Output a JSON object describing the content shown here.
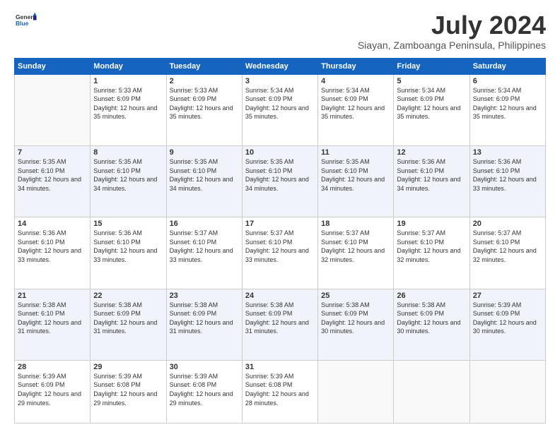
{
  "header": {
    "logo_line1": "General",
    "logo_line2": "Blue",
    "title": "July 2024",
    "subtitle": "Siayan, Zamboanga Peninsula, Philippines"
  },
  "columns": [
    "Sunday",
    "Monday",
    "Tuesday",
    "Wednesday",
    "Thursday",
    "Friday",
    "Saturday"
  ],
  "weeks": [
    [
      {
        "day": "",
        "sunrise": "",
        "sunset": "",
        "daylight": ""
      },
      {
        "day": "1",
        "sunrise": "Sunrise: 5:33 AM",
        "sunset": "Sunset: 6:09 PM",
        "daylight": "Daylight: 12 hours and 35 minutes."
      },
      {
        "day": "2",
        "sunrise": "Sunrise: 5:33 AM",
        "sunset": "Sunset: 6:09 PM",
        "daylight": "Daylight: 12 hours and 35 minutes."
      },
      {
        "day": "3",
        "sunrise": "Sunrise: 5:34 AM",
        "sunset": "Sunset: 6:09 PM",
        "daylight": "Daylight: 12 hours and 35 minutes."
      },
      {
        "day": "4",
        "sunrise": "Sunrise: 5:34 AM",
        "sunset": "Sunset: 6:09 PM",
        "daylight": "Daylight: 12 hours and 35 minutes."
      },
      {
        "day": "5",
        "sunrise": "Sunrise: 5:34 AM",
        "sunset": "Sunset: 6:09 PM",
        "daylight": "Daylight: 12 hours and 35 minutes."
      },
      {
        "day": "6",
        "sunrise": "Sunrise: 5:34 AM",
        "sunset": "Sunset: 6:09 PM",
        "daylight": "Daylight: 12 hours and 35 minutes."
      }
    ],
    [
      {
        "day": "7",
        "sunrise": "Sunrise: 5:35 AM",
        "sunset": "Sunset: 6:10 PM",
        "daylight": "Daylight: 12 hours and 34 minutes."
      },
      {
        "day": "8",
        "sunrise": "Sunrise: 5:35 AM",
        "sunset": "Sunset: 6:10 PM",
        "daylight": "Daylight: 12 hours and 34 minutes."
      },
      {
        "day": "9",
        "sunrise": "Sunrise: 5:35 AM",
        "sunset": "Sunset: 6:10 PM",
        "daylight": "Daylight: 12 hours and 34 minutes."
      },
      {
        "day": "10",
        "sunrise": "Sunrise: 5:35 AM",
        "sunset": "Sunset: 6:10 PM",
        "daylight": "Daylight: 12 hours and 34 minutes."
      },
      {
        "day": "11",
        "sunrise": "Sunrise: 5:35 AM",
        "sunset": "Sunset: 6:10 PM",
        "daylight": "Daylight: 12 hours and 34 minutes."
      },
      {
        "day": "12",
        "sunrise": "Sunrise: 5:36 AM",
        "sunset": "Sunset: 6:10 PM",
        "daylight": "Daylight: 12 hours and 34 minutes."
      },
      {
        "day": "13",
        "sunrise": "Sunrise: 5:36 AM",
        "sunset": "Sunset: 6:10 PM",
        "daylight": "Daylight: 12 hours and 33 minutes."
      }
    ],
    [
      {
        "day": "14",
        "sunrise": "Sunrise: 5:36 AM",
        "sunset": "Sunset: 6:10 PM",
        "daylight": "Daylight: 12 hours and 33 minutes."
      },
      {
        "day": "15",
        "sunrise": "Sunrise: 5:36 AM",
        "sunset": "Sunset: 6:10 PM",
        "daylight": "Daylight: 12 hours and 33 minutes."
      },
      {
        "day": "16",
        "sunrise": "Sunrise: 5:37 AM",
        "sunset": "Sunset: 6:10 PM",
        "daylight": "Daylight: 12 hours and 33 minutes."
      },
      {
        "day": "17",
        "sunrise": "Sunrise: 5:37 AM",
        "sunset": "Sunset: 6:10 PM",
        "daylight": "Daylight: 12 hours and 33 minutes."
      },
      {
        "day": "18",
        "sunrise": "Sunrise: 5:37 AM",
        "sunset": "Sunset: 6:10 PM",
        "daylight": "Daylight: 12 hours and 32 minutes."
      },
      {
        "day": "19",
        "sunrise": "Sunrise: 5:37 AM",
        "sunset": "Sunset: 6:10 PM",
        "daylight": "Daylight: 12 hours and 32 minutes."
      },
      {
        "day": "20",
        "sunrise": "Sunrise: 5:37 AM",
        "sunset": "Sunset: 6:10 PM",
        "daylight": "Daylight: 12 hours and 32 minutes."
      }
    ],
    [
      {
        "day": "21",
        "sunrise": "Sunrise: 5:38 AM",
        "sunset": "Sunset: 6:10 PM",
        "daylight": "Daylight: 12 hours and 31 minutes."
      },
      {
        "day": "22",
        "sunrise": "Sunrise: 5:38 AM",
        "sunset": "Sunset: 6:09 PM",
        "daylight": "Daylight: 12 hours and 31 minutes."
      },
      {
        "day": "23",
        "sunrise": "Sunrise: 5:38 AM",
        "sunset": "Sunset: 6:09 PM",
        "daylight": "Daylight: 12 hours and 31 minutes."
      },
      {
        "day": "24",
        "sunrise": "Sunrise: 5:38 AM",
        "sunset": "Sunset: 6:09 PM",
        "daylight": "Daylight: 12 hours and 31 minutes."
      },
      {
        "day": "25",
        "sunrise": "Sunrise: 5:38 AM",
        "sunset": "Sunset: 6:09 PM",
        "daylight": "Daylight: 12 hours and 30 minutes."
      },
      {
        "day": "26",
        "sunrise": "Sunrise: 5:38 AM",
        "sunset": "Sunset: 6:09 PM",
        "daylight": "Daylight: 12 hours and 30 minutes."
      },
      {
        "day": "27",
        "sunrise": "Sunrise: 5:39 AM",
        "sunset": "Sunset: 6:09 PM",
        "daylight": "Daylight: 12 hours and 30 minutes."
      }
    ],
    [
      {
        "day": "28",
        "sunrise": "Sunrise: 5:39 AM",
        "sunset": "Sunset: 6:09 PM",
        "daylight": "Daylight: 12 hours and 29 minutes."
      },
      {
        "day": "29",
        "sunrise": "Sunrise: 5:39 AM",
        "sunset": "Sunset: 6:08 PM",
        "daylight": "Daylight: 12 hours and 29 minutes."
      },
      {
        "day": "30",
        "sunrise": "Sunrise: 5:39 AM",
        "sunset": "Sunset: 6:08 PM",
        "daylight": "Daylight: 12 hours and 29 minutes."
      },
      {
        "day": "31",
        "sunrise": "Sunrise: 5:39 AM",
        "sunset": "Sunset: 6:08 PM",
        "daylight": "Daylight: 12 hours and 28 minutes."
      },
      {
        "day": "",
        "sunrise": "",
        "sunset": "",
        "daylight": ""
      },
      {
        "day": "",
        "sunrise": "",
        "sunset": "",
        "daylight": ""
      },
      {
        "day": "",
        "sunrise": "",
        "sunset": "",
        "daylight": ""
      }
    ]
  ]
}
